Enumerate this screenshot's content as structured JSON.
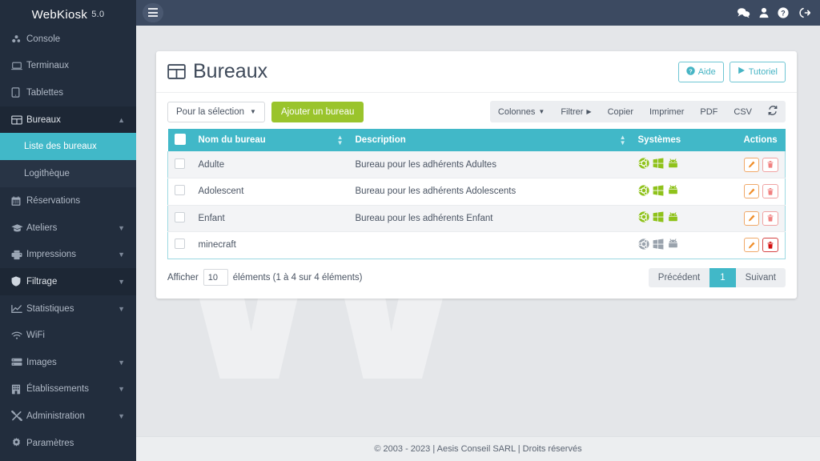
{
  "brand": {
    "name": "WebKiosk",
    "version": "5.0"
  },
  "sidebar": {
    "items": [
      {
        "label": "Console",
        "icon": "console-icon",
        "caret": false
      },
      {
        "label": "Terminaux",
        "icon": "laptop-icon",
        "caret": false
      },
      {
        "label": "Tablettes",
        "icon": "tablet-icon",
        "caret": false
      },
      {
        "label": "Bureaux",
        "icon": "table-icon",
        "caret": true,
        "open": true
      },
      {
        "label": "Réservations",
        "icon": "calendar-icon",
        "caret": false
      },
      {
        "label": "Ateliers",
        "icon": "graduation-cap-icon",
        "caret": true
      },
      {
        "label": "Impressions",
        "icon": "printer-icon",
        "caret": true
      },
      {
        "label": "Filtrage",
        "icon": "shield-icon",
        "caret": true
      },
      {
        "label": "Statistiques",
        "icon": "chart-line-icon",
        "caret": true
      },
      {
        "label": "WiFi",
        "icon": "wifi-icon",
        "caret": false
      },
      {
        "label": "Images",
        "icon": "server-icon",
        "caret": true
      },
      {
        "label": "Établissements",
        "icon": "building-icon",
        "caret": true
      },
      {
        "label": "Administration",
        "icon": "tools-icon",
        "caret": true
      },
      {
        "label": "Paramètres",
        "icon": "gear-icon",
        "caret": false
      }
    ],
    "submenu": [
      {
        "label": "Liste des bureaux",
        "active": true
      },
      {
        "label": "Logithèque",
        "active": false
      }
    ]
  },
  "topbar": {
    "menu_toggle": "hamburger-icon",
    "icons": [
      {
        "name": "comments-icon"
      },
      {
        "name": "user-icon"
      },
      {
        "name": "help-icon",
        "caret": true
      },
      {
        "name": "sign-out-icon"
      }
    ]
  },
  "card": {
    "title": "Bureaux",
    "help_label": "Aide",
    "tutorial_label": "Tutoriel",
    "selection_label": "Pour la sélection",
    "add_label": "Ajouter un bureau",
    "tools": [
      {
        "label": "Colonnes",
        "caret": "down"
      },
      {
        "label": "Filtrer",
        "caret": "right"
      },
      {
        "label": "Copier",
        "caret": ""
      },
      {
        "label": "Imprimer",
        "caret": ""
      },
      {
        "label": "PDF",
        "caret": ""
      },
      {
        "label": "CSV",
        "caret": ""
      },
      {
        "label": "",
        "caret": "",
        "icon": "refresh-icon"
      }
    ]
  },
  "table": {
    "columns": [
      "Nom du bureau",
      "Description",
      "Systèmes",
      "Actions"
    ],
    "rows": [
      {
        "name": "Adulte",
        "description": "Bureau pour les adhérents Adultes",
        "systems": [
          "ubuntu",
          "windows",
          "android"
        ],
        "enabled": true
      },
      {
        "name": "Adolescent",
        "description": "Bureau pour les adhérents Adolescents",
        "systems": [
          "ubuntu",
          "windows",
          "android"
        ],
        "enabled": true
      },
      {
        "name": "Enfant",
        "description": "Bureau pour les adhérents Enfant",
        "systems": [
          "ubuntu",
          "windows",
          "android"
        ],
        "enabled": true
      },
      {
        "name": "minecraft",
        "description": "",
        "systems": [
          "ubuntu",
          "windows",
          "android"
        ],
        "enabled": false
      }
    ]
  },
  "pagination": {
    "show_label": "Afficher",
    "page_length": "10",
    "entries_label": "éléments (1 à 4 sur 4 éléments)",
    "previous": "Précédent",
    "current_page": "1",
    "next": "Suivant"
  },
  "footer": {
    "copyright": "© 2003 - 2023 | Aesis Conseil SARL | Droits réservés"
  },
  "colors": {
    "sidebar_bg": "#222d3d",
    "accent_teal": "#41b8c8",
    "accent_green": "#9ac42c",
    "topbar_bg": "#3c4a61",
    "edit_orange": "#f08c2e",
    "delete_red": "#d30f0f",
    "ubuntu_green": "#8fc21b",
    "disabled_gray": "#9aa3ad"
  },
  "watermark": {
    "letter": "W"
  }
}
